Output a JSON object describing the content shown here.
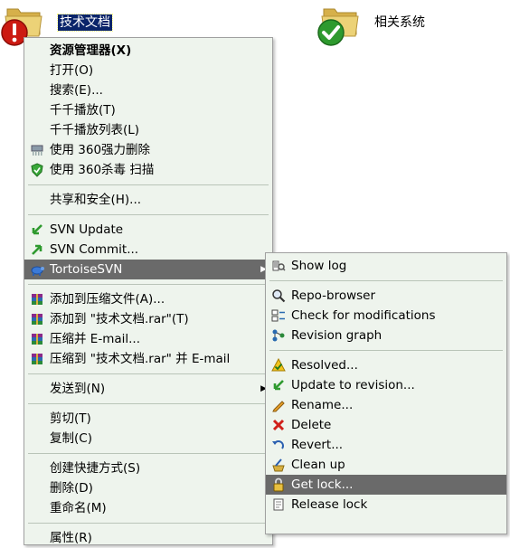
{
  "desktop": {
    "folders": [
      {
        "label": "技术文档",
        "status": "modified"
      },
      {
        "label": "相关系统",
        "status": "normal"
      }
    ]
  },
  "context_menu": {
    "items": [
      {
        "label": "资源管理器(X)",
        "bold": true
      },
      {
        "label": "打开(O)"
      },
      {
        "label": "搜索(E)..."
      },
      {
        "label": "千千播放(T)"
      },
      {
        "label": "千千播放列表(L)"
      },
      {
        "label": "使用 360强力删除",
        "icon": "shredder-icon"
      },
      {
        "label": "使用 360杀毒 扫描",
        "icon": "shield-icon"
      },
      {
        "label": "共享和安全(H)..."
      },
      {
        "label": "SVN Update",
        "icon": "svn-update-icon"
      },
      {
        "label": "SVN Commit...",
        "icon": "svn-commit-icon"
      },
      {
        "label": "TortoiseSVN",
        "icon": "tortoise-icon",
        "submenu": true
      },
      {
        "label": "添加到压缩文件(A)...",
        "icon": "winrar-icon"
      },
      {
        "label": "添加到 \"技术文档.rar\"(T)",
        "icon": "winrar-icon"
      },
      {
        "label": "压缩并 E-mail...",
        "icon": "winrar-icon"
      },
      {
        "label": "压缩到 \"技术文档.rar\" 并 E-mail",
        "icon": "winrar-icon"
      },
      {
        "label": "发送到(N)",
        "submenu": true
      },
      {
        "label": "剪切(T)"
      },
      {
        "label": "复制(C)"
      },
      {
        "label": "创建快捷方式(S)"
      },
      {
        "label": "删除(D)"
      },
      {
        "label": "重命名(M)"
      },
      {
        "label": "属性(R)"
      }
    ]
  },
  "tortoise_submenu": {
    "items": [
      {
        "label": "Show log",
        "icon": "show-log-icon"
      },
      {
        "label": "Repo-browser",
        "icon": "repo-browser-icon"
      },
      {
        "label": "Check for modifications",
        "icon": "check-modifications-icon"
      },
      {
        "label": "Revision graph",
        "icon": "revision-graph-icon"
      },
      {
        "label": "Resolved...",
        "icon": "resolved-icon"
      },
      {
        "label": "Update to revision...",
        "icon": "update-revision-icon"
      },
      {
        "label": "Rename...",
        "icon": "rename-icon"
      },
      {
        "label": "Delete",
        "icon": "delete-icon"
      },
      {
        "label": "Revert...",
        "icon": "revert-icon"
      },
      {
        "label": "Clean up",
        "icon": "cleanup-icon"
      },
      {
        "label": "Get lock...",
        "icon": "get-lock-icon",
        "highlighted": true
      },
      {
        "label": "Release lock",
        "icon": "release-lock-icon"
      }
    ]
  },
  "colors": {
    "menu_background": "#eef4ed",
    "highlight": "#6a6a6a",
    "selection": "#0a246a",
    "modified_badge": "#cc1a12",
    "normal_badge": "#2e9a2e",
    "folder": "#e8c860"
  }
}
